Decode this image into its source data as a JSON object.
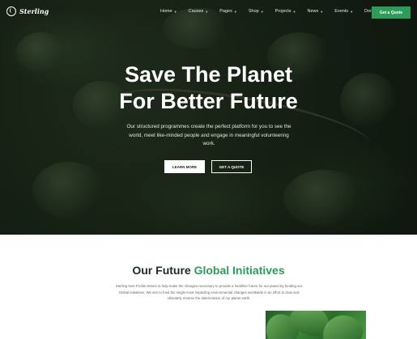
{
  "brand": {
    "name": "Sterling"
  },
  "nav": {
    "items": [
      {
        "label": "Home",
        "chevron": true
      },
      {
        "label": "Causes",
        "chevron": true
      },
      {
        "label": "Pages",
        "chevron": true
      },
      {
        "label": "Shop",
        "chevron": true
      },
      {
        "label": "Projects",
        "chevron": true
      },
      {
        "label": "News",
        "chevron": true
      },
      {
        "label": "Events",
        "chevron": true
      },
      {
        "label": "Donate",
        "chevron": true
      }
    ],
    "quote_button": "Get a Quote"
  },
  "hero": {
    "title_line1": "Save The Planet",
    "title_line2": "For Better Future",
    "subtitle": "Our structured programmes create the perfect platform for you to see the world, meet like-minded people and engage in meaningful volunteering work.",
    "learn_more": "LEARN MORE",
    "get_quote": "GET A QUOTE"
  },
  "section": {
    "title_plain": "Our Future",
    "title_accent": "Global Initiatives",
    "body": "Sterling Non-Profits strives to help make the changes necessary to provide a healthier future for our planet by funding our Global Initiatives. We aim to fund the single most impacting environmental changes worldwide in an effort to slow and ultimately reverse the deterioration of our planet earth."
  },
  "colors": {
    "accent": "#2d9b5a",
    "dark_text": "#1e2a24"
  }
}
